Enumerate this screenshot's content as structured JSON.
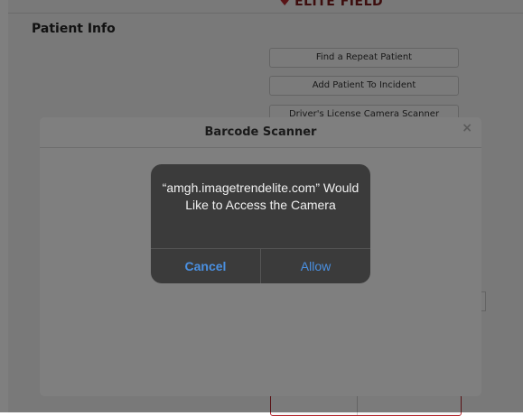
{
  "app": {
    "brand": "ELITE FIELD"
  },
  "page": {
    "section_title": "Patient Info",
    "buttons": [
      {
        "label": "Find a Repeat Patient"
      },
      {
        "label": "Add Patient To Incident"
      },
      {
        "label": "Driver's License Camera Scanner"
      }
    ]
  },
  "modal": {
    "title": "Barcode Scanner",
    "close_glyph": "×"
  },
  "alert": {
    "message": "“amgh.imagetrendelite.com” Would Like to Access the Camera",
    "cancel_label": "Cancel",
    "allow_label": "Allow"
  },
  "colors": {
    "brand": "#b3262c",
    "alert_button": "#4a90e2"
  }
}
